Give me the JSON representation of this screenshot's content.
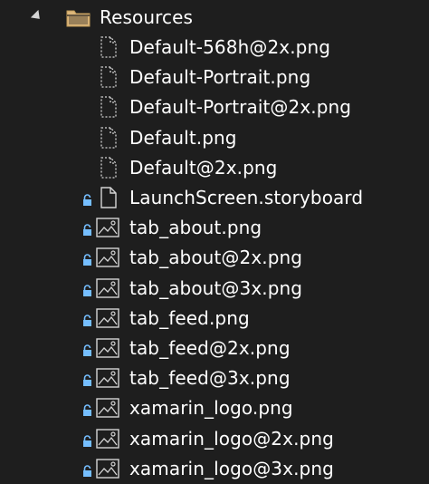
{
  "folder": {
    "label": "Resources",
    "icon": "folder-icon",
    "expanded": true
  },
  "items": [
    {
      "label": "Default-568h@2x.png",
      "icon": "file-dashed-icon",
      "locked": false
    },
    {
      "label": "Default-Portrait.png",
      "icon": "file-dashed-icon",
      "locked": false
    },
    {
      "label": "Default-Portrait@2x.png",
      "icon": "file-dashed-icon",
      "locked": false
    },
    {
      "label": "Default.png",
      "icon": "file-dashed-icon",
      "locked": false
    },
    {
      "label": "Default@2x.png",
      "icon": "file-dashed-icon",
      "locked": false
    },
    {
      "label": "LaunchScreen.storyboard",
      "icon": "file-icon",
      "locked": true
    },
    {
      "label": "tab_about.png",
      "icon": "image-file-icon",
      "locked": true
    },
    {
      "label": "tab_about@2x.png",
      "icon": "image-file-icon",
      "locked": true
    },
    {
      "label": "tab_about@3x.png",
      "icon": "image-file-icon",
      "locked": true
    },
    {
      "label": "tab_feed.png",
      "icon": "image-file-icon",
      "locked": true
    },
    {
      "label": "tab_feed@2x.png",
      "icon": "image-file-icon",
      "locked": true
    },
    {
      "label": "tab_feed@3x.png",
      "icon": "image-file-icon",
      "locked": true
    },
    {
      "label": "xamarin_logo.png",
      "icon": "image-file-icon",
      "locked": true
    },
    {
      "label": "xamarin_logo@2x.png",
      "icon": "image-file-icon",
      "locked": true
    },
    {
      "label": "xamarin_logo@3x.png",
      "icon": "image-file-icon",
      "locked": true
    }
  ],
  "colors": {
    "background": "#1e1e1e",
    "text": "#ffffff",
    "folder": "#dcb67a",
    "lock": "#75beff",
    "icon_stroke": "#d4d4d4"
  }
}
